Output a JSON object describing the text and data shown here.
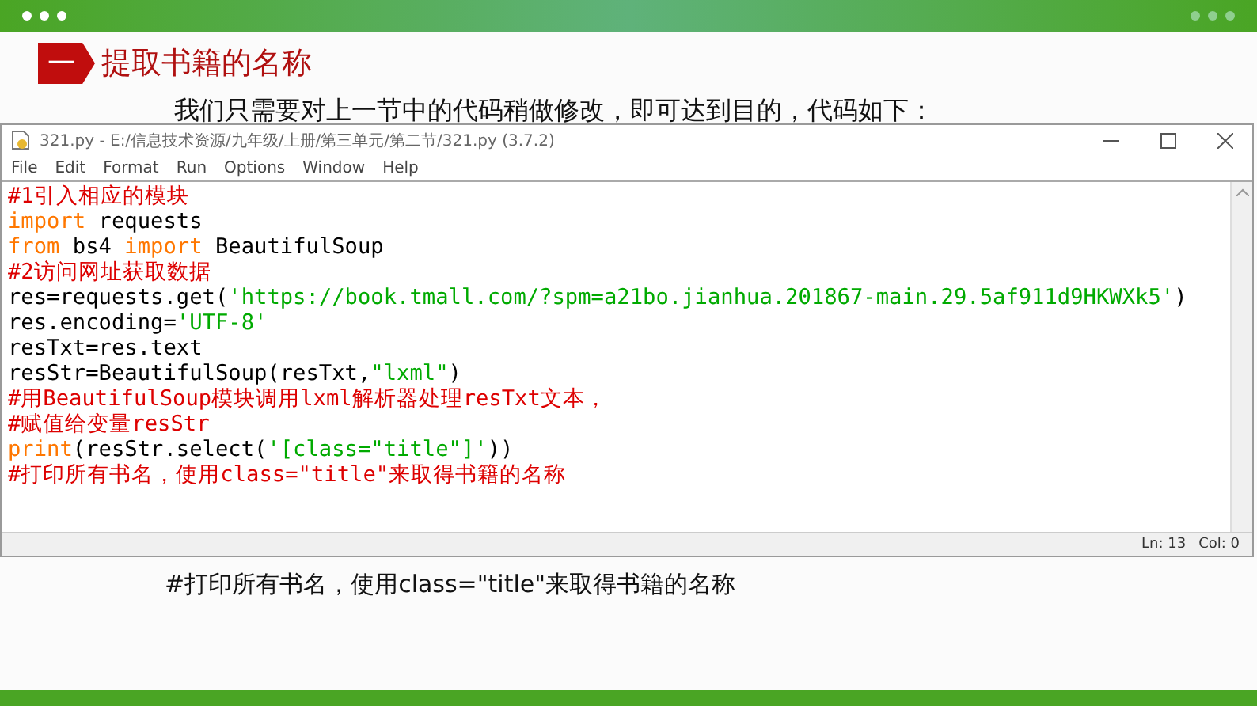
{
  "slide": {
    "badge": "一",
    "title": "提取书籍的名称",
    "intro": "我们只需要对上一节中的代码稍做修改，即可达到目的，代码如下：",
    "note": "#打印所有书名，使用class=\"title\"来取得书籍的名称"
  },
  "window": {
    "title": "321.py - E:/信息技术资源/九年级/上册/第三单元/第二节/321.py (3.7.2)",
    "menu": [
      "File",
      "Edit",
      "Format",
      "Run",
      "Options",
      "Window",
      "Help"
    ],
    "code": [
      [
        {
          "kind": "comment",
          "text": "#1引入相应的模块"
        }
      ],
      [
        {
          "kind": "keyword",
          "text": "import"
        },
        {
          "kind": "plain",
          "text": " requests"
        }
      ],
      [
        {
          "kind": "keyword",
          "text": "from"
        },
        {
          "kind": "plain",
          "text": " bs4 "
        },
        {
          "kind": "keyword",
          "text": "import"
        },
        {
          "kind": "plain",
          "text": " BeautifulSoup"
        }
      ],
      [
        {
          "kind": "comment",
          "text": "#2访问网址获取数据"
        }
      ],
      [
        {
          "kind": "plain",
          "text": "res=requests.get("
        },
        {
          "kind": "string",
          "text": "'https://book.tmall.com/?spm=a21bo.jianhua.201867-main.29.5af911d9HKWXk5'"
        },
        {
          "kind": "plain",
          "text": ")"
        }
      ],
      [
        {
          "kind": "plain",
          "text": "res.encoding="
        },
        {
          "kind": "string",
          "text": "'UTF-8'"
        }
      ],
      [
        {
          "kind": "plain",
          "text": "resTxt=res.text"
        }
      ],
      [
        {
          "kind": "plain",
          "text": "resStr=BeautifulSoup(resTxt,"
        },
        {
          "kind": "string",
          "text": "\"lxml\""
        },
        {
          "kind": "plain",
          "text": ")"
        }
      ],
      [
        {
          "kind": "comment",
          "text": "#用BeautifulSoup模块调用lxml解析器处理resTxt文本，"
        }
      ],
      [
        {
          "kind": "comment",
          "text": "#赋值给变量resStr"
        }
      ],
      [
        {
          "kind": "keyword",
          "text": "print"
        },
        {
          "kind": "plain",
          "text": "(resStr.select("
        },
        {
          "kind": "string",
          "text": "'[class=\"title\"]'"
        },
        {
          "kind": "plain",
          "text": "))"
        }
      ],
      [
        {
          "kind": "comment",
          "text": "#打印所有书名，使用class=\"title\"来取得书籍的名称"
        }
      ]
    ],
    "status": {
      "line": "Ln: 13",
      "col": "Col: 0"
    }
  }
}
